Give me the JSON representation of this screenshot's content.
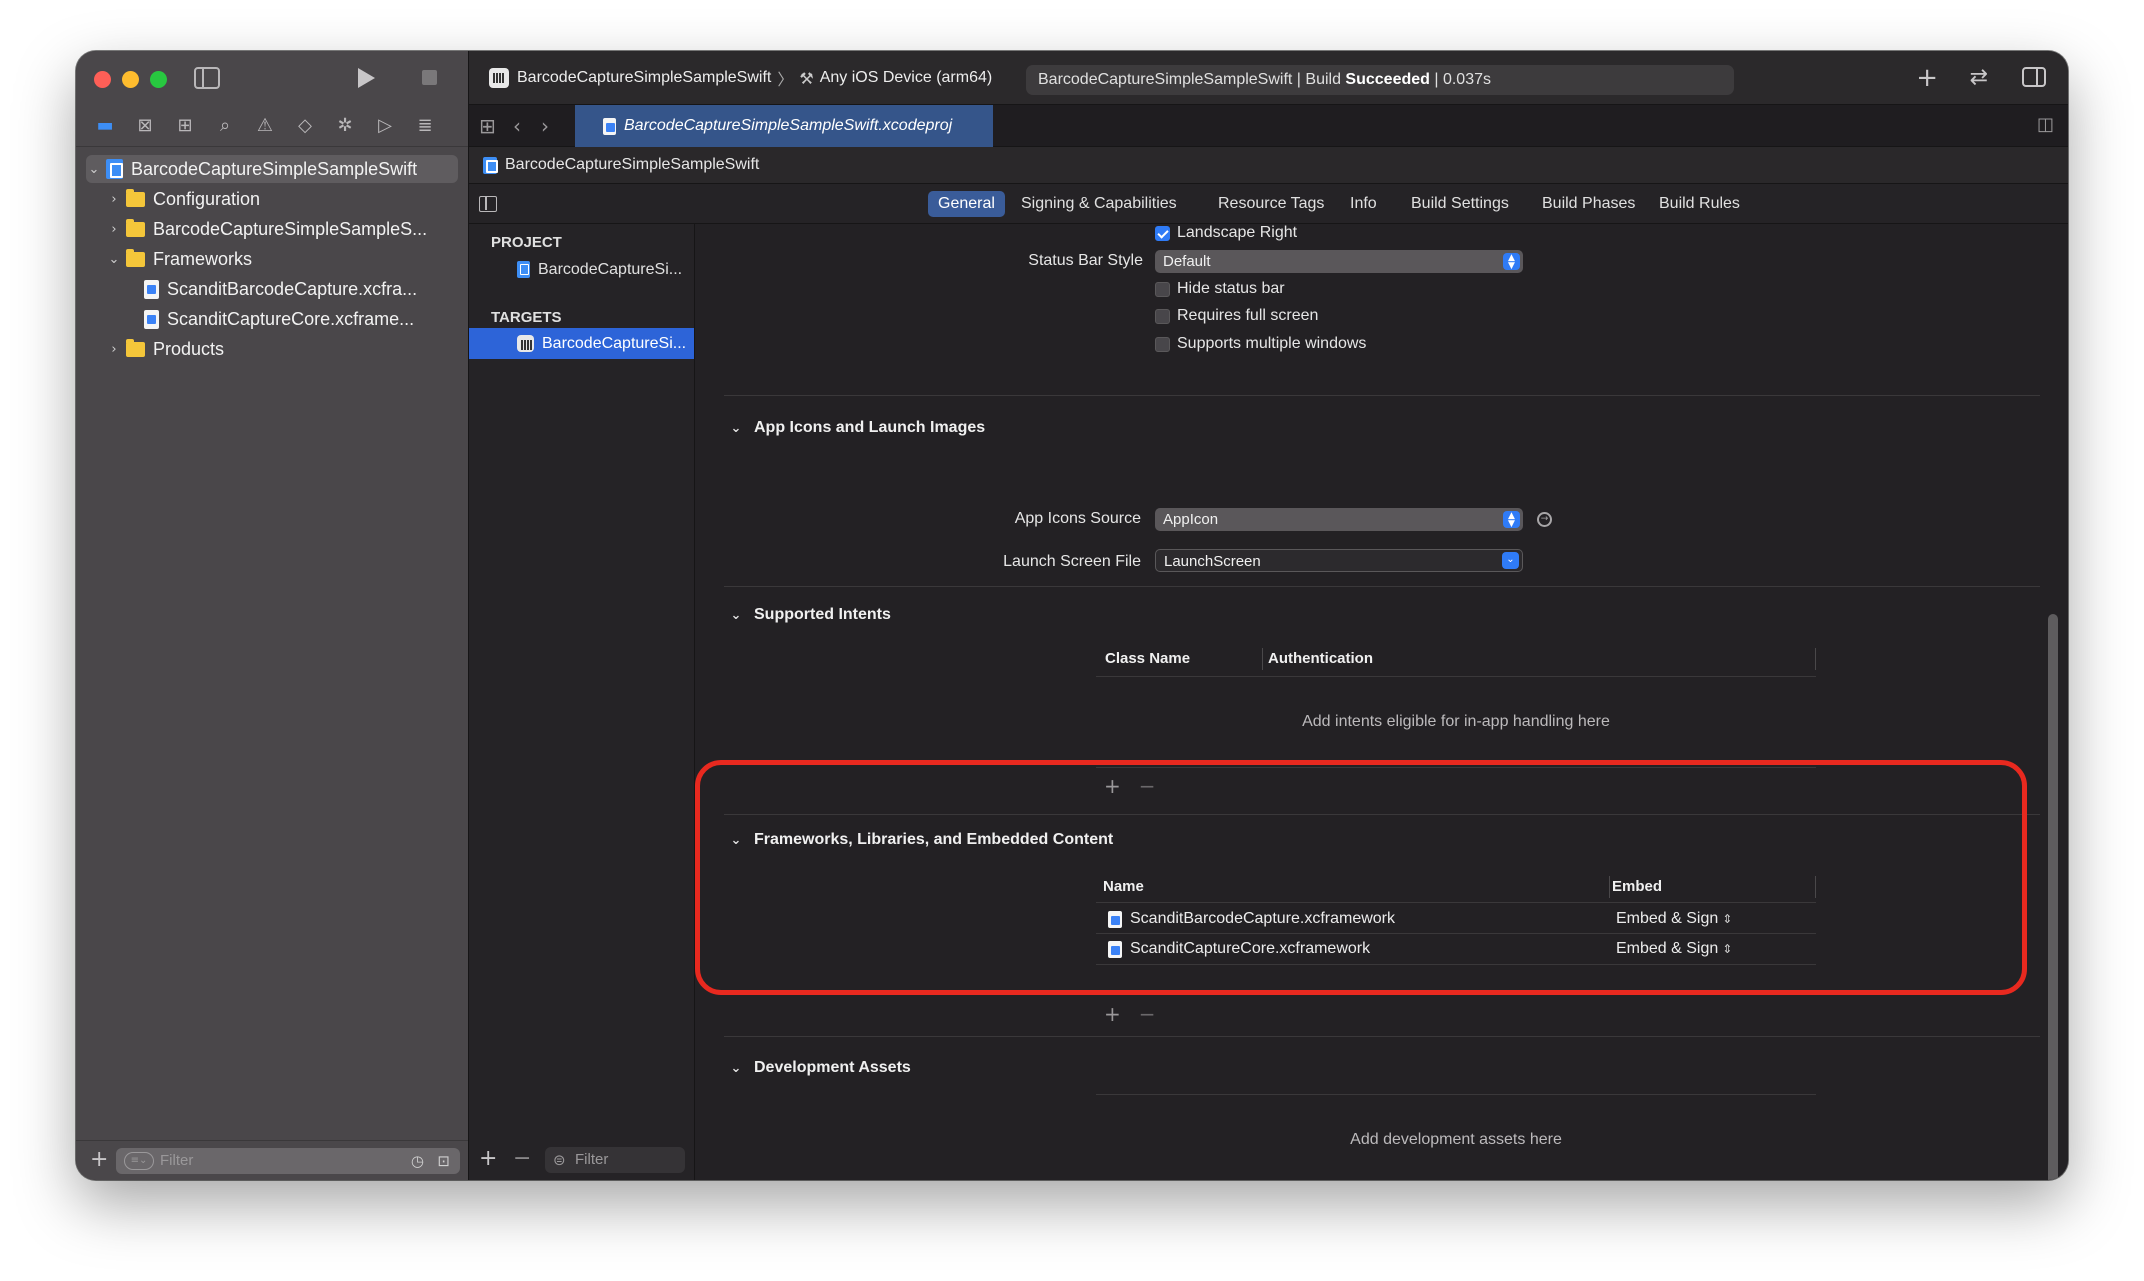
{
  "toolbar": {
    "scheme_name": "BarcodeCaptureSimpleSampleSwift",
    "destination": "Any iOS Device (arm64)",
    "activity_prefix": "BarcodeCaptureSimpleSampleSwift | Build ",
    "activity_status": "Succeeded",
    "activity_suffix": " | 0.037s"
  },
  "navigator": {
    "icons": [
      "folder-icon",
      "source-control-icon",
      "symbol-icon",
      "search-icon",
      "issue-icon",
      "test-icon",
      "debug-icon",
      "breakpoint-icon",
      "report-icon"
    ],
    "tree": [
      {
        "label": "BarcodeCaptureSimpleSampleSwift",
        "kind": "project",
        "disclosure": "open",
        "selected": true
      },
      {
        "label": "Configuration",
        "kind": "folder",
        "disclosure": "closed"
      },
      {
        "label": "BarcodeCaptureSimpleSampleS...",
        "kind": "folder",
        "disclosure": "closed"
      },
      {
        "label": "Frameworks",
        "kind": "folder",
        "disclosure": "open"
      },
      {
        "label": "ScanditBarcodeCapture.xcfra...",
        "kind": "file"
      },
      {
        "label": "ScanditCaptureCore.xcframe...",
        "kind": "file"
      },
      {
        "label": "Products",
        "kind": "folder",
        "disclosure": "closed"
      }
    ],
    "filter_placeholder": "Filter"
  },
  "tab": {
    "active_label": "BarcodeCaptureSimpleSampleSwift.xcodeproj"
  },
  "breadcrumb": {
    "label": "BarcodeCaptureSimpleSampleSwift"
  },
  "editor_tabs": [
    "General",
    "Signing & Capabilities",
    "Resource Tags",
    "Info",
    "Build Settings",
    "Build Phases",
    "Build Rules"
  ],
  "editor_tab_active": "General",
  "targets_panel": {
    "project_header": "PROJECT",
    "project_item": "BarcodeCaptureSi...",
    "targets_header": "TARGETS",
    "target_item": "BarcodeCaptureSi...",
    "filter_placeholder": "Filter"
  },
  "deployment": {
    "landscape_right": {
      "label": "Landscape Right",
      "checked": true
    },
    "status_bar_style_label": "Status Bar Style",
    "status_bar_style_value": "Default",
    "hide_status_bar": {
      "label": "Hide status bar",
      "checked": false
    },
    "requires_full_screen": {
      "label": "Requires full screen",
      "checked": false
    },
    "supports_multiple_windows": {
      "label": "Supports multiple windows",
      "checked": false
    }
  },
  "app_icons": {
    "title": "App Icons and Launch Images",
    "icons_source_label": "App Icons Source",
    "icons_source_value": "AppIcon",
    "launch_screen_label": "Launch Screen File",
    "launch_screen_value": "LaunchScreen"
  },
  "intents": {
    "title": "Supported Intents",
    "col_class": "Class Name",
    "col_auth": "Authentication",
    "empty": "Add intents eligible for in-app handling here"
  },
  "frameworks": {
    "title": "Frameworks, Libraries, and Embedded Content",
    "col_name": "Name",
    "col_embed": "Embed",
    "rows": [
      {
        "name": "ScanditBarcodeCapture.xcframework",
        "embed": "Embed & Sign"
      },
      {
        "name": "ScanditCaptureCore.xcframework",
        "embed": "Embed & Sign"
      }
    ]
  },
  "dev_assets": {
    "title": "Development Assets",
    "empty": "Add development assets here"
  },
  "colors": {
    "window_bg": "#232124",
    "sidebar_bg": "#4a474a",
    "accent": "#2f7bf6",
    "highlight": "#e8291f"
  }
}
